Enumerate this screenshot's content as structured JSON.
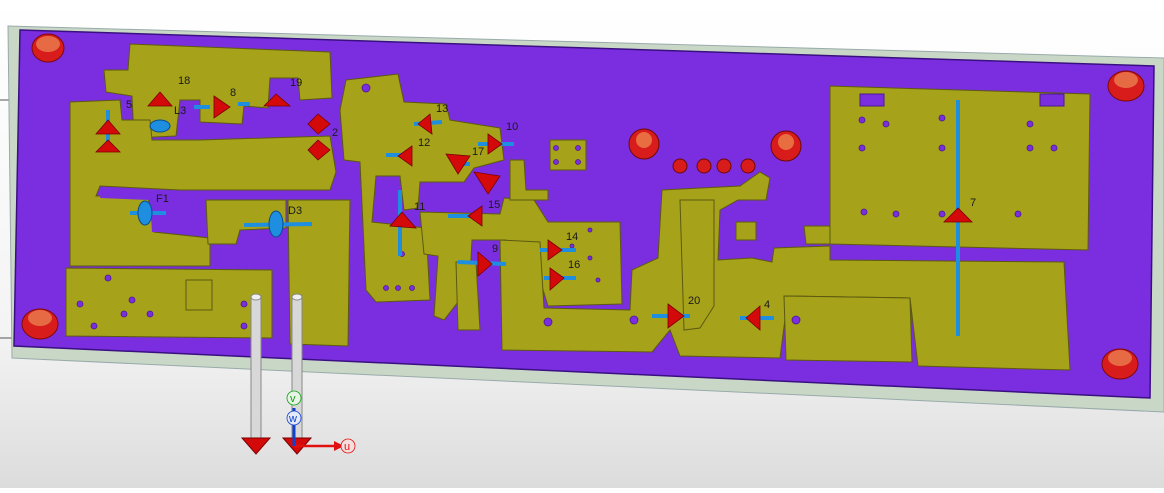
{
  "viewport": {
    "name": "pcb-3d-viewport"
  },
  "colors": {
    "substrate": "#7a2ee0",
    "copper": "#a6a21a",
    "board_edge": "#c9d8c6",
    "port_arrow": "#d40a0a",
    "port_marker": "#1e8fe0",
    "axis_u": "#e01010",
    "axis_v": "#10a010",
    "axis_w": "#1040d0"
  },
  "ports": [
    {
      "id": "p1",
      "label": "1"
    },
    {
      "id": "p2",
      "label": "2"
    },
    {
      "id": "p3",
      "label": "3"
    },
    {
      "id": "p4",
      "label": "4"
    },
    {
      "id": "p5",
      "label": "5"
    },
    {
      "id": "p7",
      "label": "7"
    },
    {
      "id": "p8",
      "label": "8"
    },
    {
      "id": "p9",
      "label": "9"
    },
    {
      "id": "p10",
      "label": "10"
    },
    {
      "id": "p11",
      "label": "11"
    },
    {
      "id": "p12",
      "label": "12"
    },
    {
      "id": "p13",
      "label": "13"
    },
    {
      "id": "p14",
      "label": "14"
    },
    {
      "id": "p15",
      "label": "15"
    },
    {
      "id": "p16",
      "label": "16"
    },
    {
      "id": "p17",
      "label": "17"
    },
    {
      "id": "p18",
      "label": "18"
    },
    {
      "id": "p19",
      "label": "19"
    },
    {
      "id": "p20",
      "label": "20"
    }
  ],
  "components": {
    "l3": "L3",
    "f1": "F1",
    "d3": "D3"
  },
  "axes": {
    "u": "u",
    "v": "v",
    "w": "w"
  }
}
